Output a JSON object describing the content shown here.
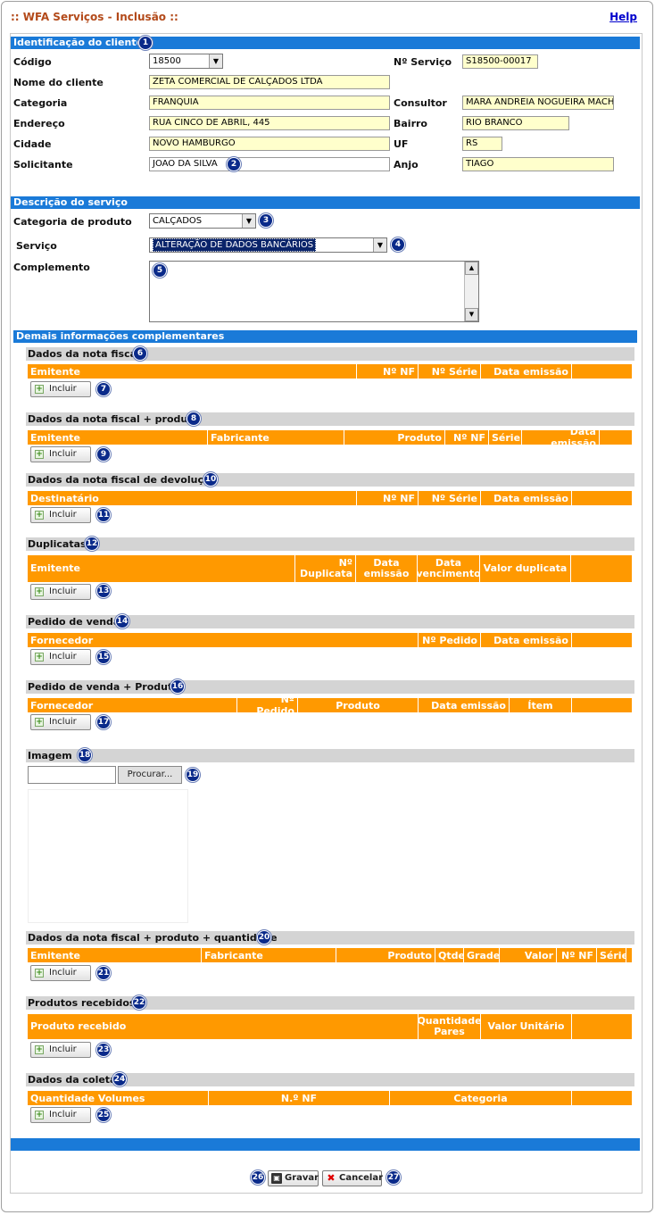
{
  "window": {
    "title": ":: WFA Serviços - Inclusão ::",
    "help": "Help"
  },
  "section1": {
    "title": "Identificação do cliente",
    "badge": "1",
    "codigo_label": "Código",
    "codigo_value": "18500",
    "nservico_label": "Nº Serviço",
    "nservico_value": "S18500-00017",
    "nome_label": "Nome do cliente",
    "nome_value": "ZETA COMERCIAL DE CALÇADOS LTDA",
    "categoria_label": "Categoria",
    "categoria_value": "FRANQUIA",
    "consultor_label": "Consultor",
    "consultor_value": "MARA ANDREIA NOGUEIRA MACH",
    "endereco_label": "Endereço",
    "endereco_value": "RUA CINCO DE ABRIL, 445",
    "bairro_label": "Bairro",
    "bairro_value": "RIO BRANCO",
    "cidade_label": "Cidade",
    "cidade_value": "NOVO HAMBURGO",
    "uf_label": "UF",
    "uf_value": "RS",
    "solicitante_label": "Solicitante",
    "solicitante_value": "JOAO DA SILVA",
    "solicitante_badge": "2",
    "anjo_label": "Anjo",
    "anjo_value": "TIAGO"
  },
  "section2": {
    "title": "Descrição do serviço",
    "catprod_label": "Categoria de produto",
    "catprod_value": "CALÇADOS",
    "catprod_badge": "3",
    "servico_label": "Serviço",
    "servico_value": "ALTERAÇÃO DE DADOS BANCÁRIOS",
    "servico_badge": "4",
    "complemento_label": "Complemento",
    "complemento_badge": "5"
  },
  "section3": {
    "title": "Demais informações complementares"
  },
  "include_label": "Incluir",
  "nf": {
    "title": "Dados da nota fiscal",
    "badge": "6",
    "btn_badge": "7",
    "cols": [
      "Emitente",
      "Nº NF",
      "Nº Série",
      "Data emissão",
      ""
    ]
  },
  "nfprod": {
    "title": "Dados da nota fiscal + produto",
    "badge": "8",
    "btn_badge": "9",
    "cols": [
      "Emitente",
      "Fabricante",
      "Produto",
      "Nº NF",
      "Série",
      "Data emissão",
      ""
    ]
  },
  "nfdev": {
    "title": "Dados da nota fiscal de devolução",
    "badge": "10",
    "btn_badge": "11",
    "cols": [
      "Destinatário",
      "Nº NF",
      "Nº Série",
      "Data emissão",
      ""
    ]
  },
  "dup": {
    "title": "Duplicatas",
    "badge": "12",
    "btn_badge": "13",
    "cols": [
      "Emitente",
      "Nº Duplicata",
      "Data emissão",
      "Data vencimento",
      "Valor duplicata",
      ""
    ]
  },
  "pedido": {
    "title": "Pedido de venda",
    "badge": "14",
    "btn_badge": "15",
    "cols": [
      "Fornecedor",
      "Nº Pedido",
      "Data emissão",
      ""
    ]
  },
  "pedprod": {
    "title": "Pedido de venda + Produto",
    "badge": "16",
    "btn_badge": "17",
    "cols": [
      "Fornecedor",
      "Nº Pedido",
      "Produto",
      "Data emissão",
      "Ítem",
      ""
    ]
  },
  "imagem": {
    "title": "Imagem",
    "badge": "18",
    "browse_label": "Procurar...",
    "browse_badge": "19"
  },
  "nfprodqtd": {
    "title": "Dados da nota fiscal + produto + quantidade",
    "badge": "20",
    "btn_badge": "21",
    "cols": [
      "Emitente",
      "Fabricante",
      "Produto",
      "Qtde",
      "Grade",
      "Valor",
      "Nº NF",
      "Série",
      ""
    ]
  },
  "prodrec": {
    "title": "Produtos recebidos",
    "badge": "22",
    "btn_badge": "23",
    "cols": [
      "Produto recebido",
      "Quantidade Pares",
      "Valor Unitário",
      ""
    ]
  },
  "coleta": {
    "title": "Dados da coleta",
    "badge": "24",
    "btn_badge": "25",
    "cols": [
      "Quantidade Volumes",
      "N.º NF",
      "Categoria",
      ""
    ]
  },
  "footer": {
    "save_label": "Gravar",
    "save_badge": "26",
    "cancel_label": "Cancelar",
    "cancel_badge": "27"
  },
  "colors": {
    "blue_bar": "#1a7ad8",
    "orange_header": "#ff9900",
    "field_bg": "#ffffcc",
    "badge": "#0a2a8a"
  }
}
